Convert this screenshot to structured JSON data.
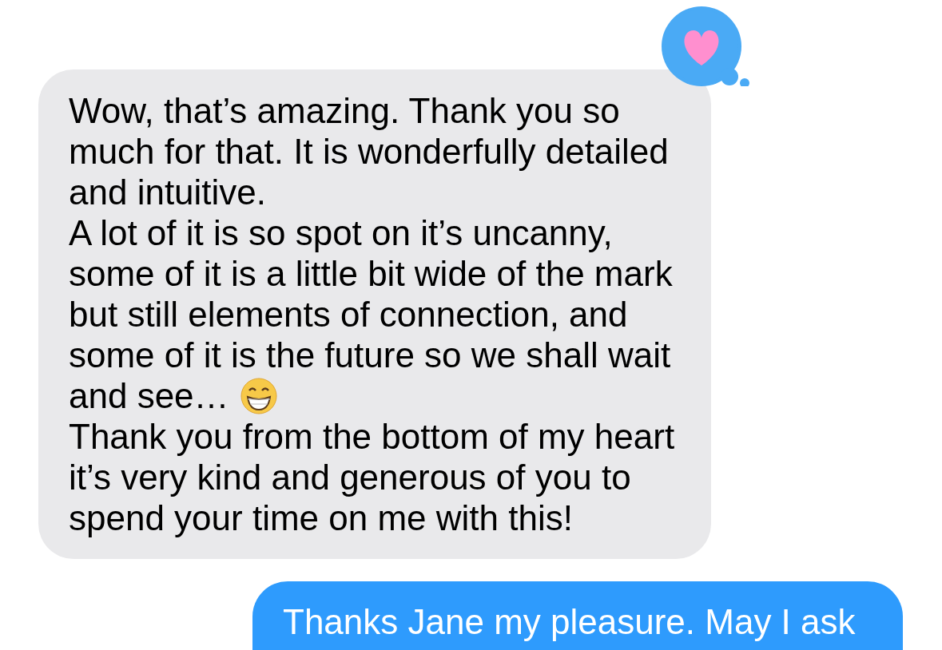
{
  "messages": [
    {
      "kind": "received",
      "heart_reaction": true,
      "lines": [
        {
          "text": "Wow, that’s amazing. Thank you so"
        },
        {
          "text": "much for that. It is wonderfully detailed"
        },
        {
          "text": "and intuitive."
        },
        {
          "text": "A lot of it is so spot on it’s uncanny,"
        },
        {
          "text": "some of it is a little bit wide of the mark"
        },
        {
          "text": "but still elements of connection, and"
        },
        {
          "text": "some of it is the future so we shall wait"
        },
        {
          "text": "and see…",
          "grin_emoji": true
        },
        {
          "text": "Thank you from the bottom of my heart"
        },
        {
          "text": "it’s very kind and generous of you to"
        },
        {
          "text": "spend your time on me with this!"
        }
      ]
    },
    {
      "kind": "sent",
      "heart_reaction": false,
      "lines": [
        {
          "text": "Thanks Jane my pleasure. May I ask"
        }
      ]
    }
  ]
}
